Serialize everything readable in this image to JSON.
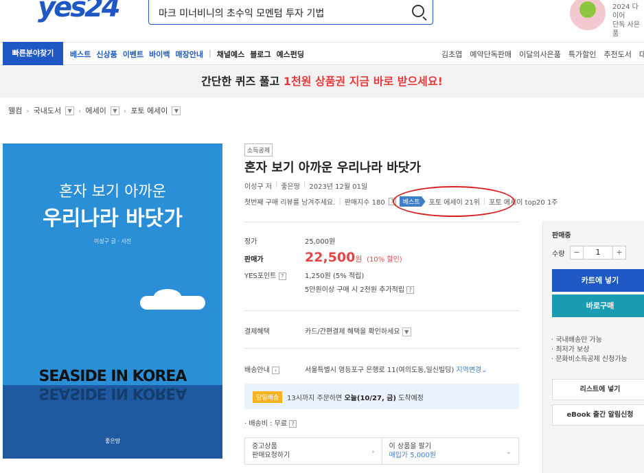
{
  "header": {
    "logo": "yes24",
    "search_value": "마크 미너비니의 초수익 모멘텀 투자 기법",
    "promo_line1": "2024 다이어",
    "promo_line2": "단독 사은품"
  },
  "nav": {
    "quick": "빠른분야찾기",
    "main": [
      "베스트",
      "신상품",
      "이벤트",
      "바이백",
      "매장안내"
    ],
    "sub": [
      "채널예스",
      "블로그",
      "예스펀딩"
    ],
    "right": [
      "김초엽",
      "예약단독판매",
      "이달의사은품",
      "특가할인",
      "추천도서",
      "대용"
    ]
  },
  "quiz": {
    "pre": "간단한 퀴즈 풀고 ",
    "highlight": "1천원 상품권 지금 바로 받으세요!"
  },
  "breadcrumb": [
    "웰컴",
    "국내도서",
    "에세이",
    "포토 에세이"
  ],
  "cover": {
    "line1": "혼자 보기 아까운",
    "line2": "우리나라 바닷가",
    "author": "이성구 글 · 사진",
    "sea_text": "SEASIDE IN KOREA",
    "publisher": "좋은땅"
  },
  "book": {
    "badge": "소득공제",
    "title": "혼자 보기 아까운 우리나라 바닷가",
    "author": "이성구 저",
    "publisher": "좋은땅",
    "date": "2023년 12월 01일",
    "review_prompt": "첫번째 구매 리뷰를 남겨주세요.",
    "index": "판매지수 180",
    "best_tag": "베스트",
    "rank1": "포토 에세이 21위",
    "rank2": "포토 에세이 top20 1주"
  },
  "price": {
    "list_label": "정가",
    "list_value": "25,000원",
    "sale_label": "판매가",
    "sale_value": "22,500",
    "sale_unit": "원",
    "discount": "(10% 할인)",
    "point_label": "YES포인트",
    "point_value": "1,250원 (5% 적립)",
    "point_extra": "5만원이상 구매 시 2천원 추가적립"
  },
  "payment": {
    "label": "결제혜택",
    "value": "카드/간편결제 혜택을 확인하세요"
  },
  "shipping": {
    "label": "배송안내",
    "address": "서울특별시 영등포구 은행로 11(여의도동,일신빌딩)",
    "change": "지역변경",
    "dawn_badge": "당일배송",
    "dawn_pre": "13시까지 주문하면 ",
    "dawn_bold": "오늘(10/27, 금)",
    "dawn_post": " 도착예정",
    "fee": "· 배송비 : 무료"
  },
  "used": {
    "left1": "중고상품",
    "left2": "판매요청하기",
    "right1": "이 상품을 팔기",
    "right2": "매입가 5,000원"
  },
  "side": {
    "status": "판매중",
    "qty_label": "수량",
    "qty": "1",
    "minus": "−",
    "plus": "+",
    "cart": "카트에 넣기",
    "buy": "바로구매",
    "info": [
      "· 국내배송만 가능",
      "· 최저가 보상",
      "· 문화비소득공제 신청가능"
    ],
    "wishlist": "리스트에 넣기",
    "ebook": "eBook 출간 알림신청"
  }
}
